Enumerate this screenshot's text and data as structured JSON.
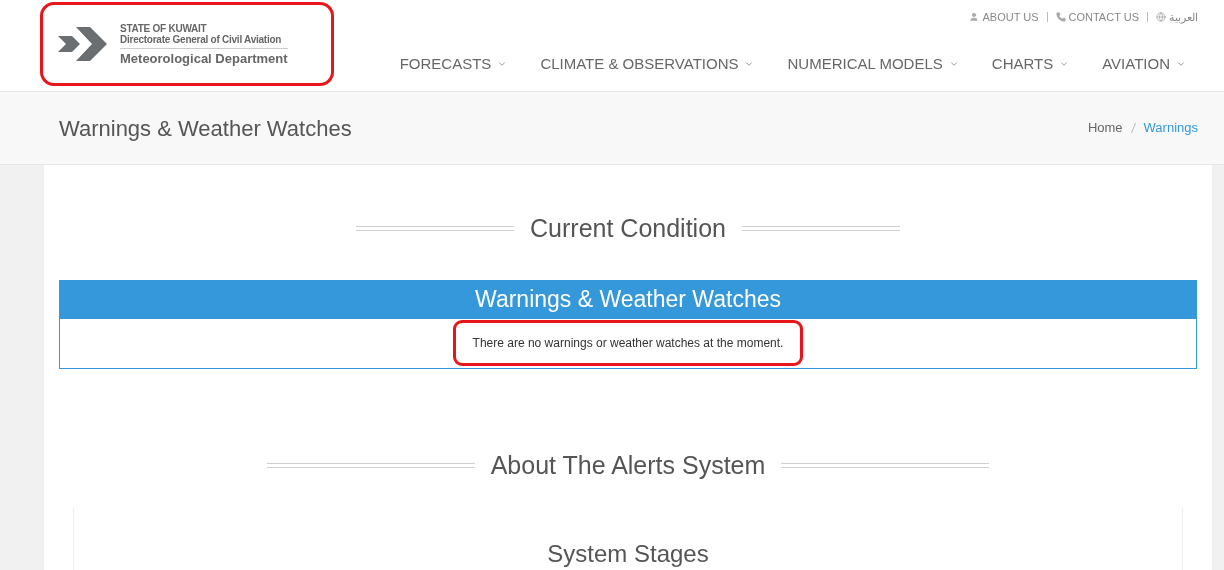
{
  "logo": {
    "line_1": "STATE OF KUWAIT",
    "line_2": "Directorate General of Civil Aviation",
    "line_3": "Meteorological Department"
  },
  "top_links": [
    {
      "kind": "user",
      "label": "ABOUT US"
    },
    {
      "kind": "phone",
      "label": "CONTACT US"
    },
    {
      "kind": "globe",
      "label": "العربية"
    }
  ],
  "nav": [
    "FORECASTS",
    "CLIMATE & OBSERVATIONS",
    "NUMERICAL MODELS",
    "CHARTS",
    "AVIATION"
  ],
  "page_title": "Warnings & Weather Watches",
  "breadcrumb": [
    {
      "label": "Home",
      "selected": false
    },
    {
      "label": "Warnings",
      "selected": true
    }
  ],
  "current_condition": {
    "heading": "Current Condition",
    "panel_title": "Warnings & Weather Watches",
    "message": "There are no warnings or weather watches at the moment."
  },
  "about": {
    "heading": "About The Alerts System",
    "card_title": "System Stages"
  }
}
